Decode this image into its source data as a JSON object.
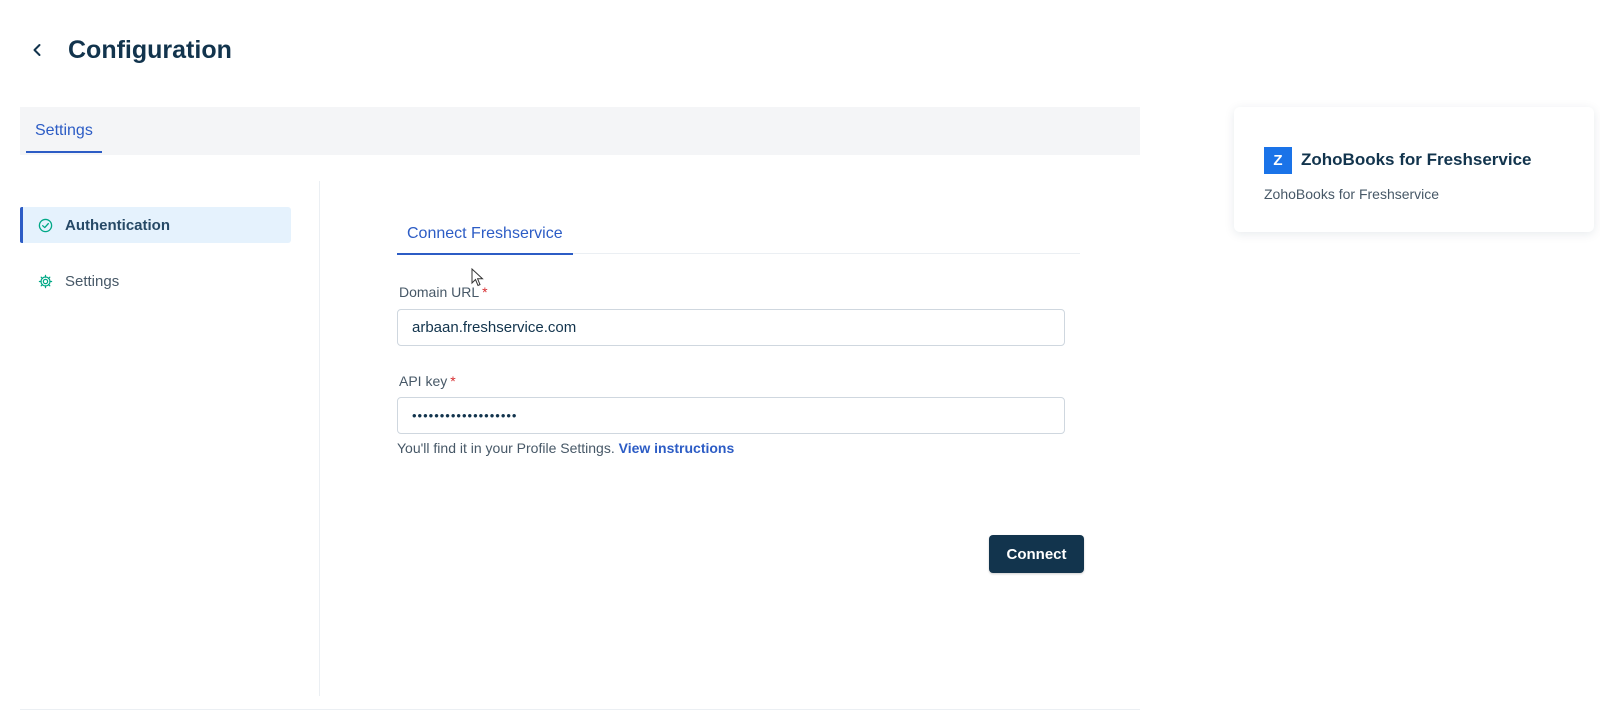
{
  "header": {
    "title": "Configuration",
    "back_icon": "chevron-left-icon"
  },
  "tabs": [
    {
      "label": "Settings",
      "active": true
    }
  ],
  "sidebar": {
    "items": [
      {
        "label": "Authentication",
        "icon": "check-circle-icon",
        "active": true
      },
      {
        "label": "Settings",
        "icon": "gear-icon",
        "active": false
      }
    ]
  },
  "main": {
    "tab_label": "Connect Freshservice",
    "domain": {
      "label": "Domain URL",
      "required_mark": "*",
      "value": "arbaan.freshservice.com"
    },
    "api_key": {
      "label": "API key",
      "required_mark": "*",
      "value": "•••••••••••••••••••"
    },
    "hint_text": "You'll find it in your Profile Settings.",
    "hint_link": "View instructions",
    "connect_label": "Connect"
  },
  "app_card": {
    "logo_letter": "Z",
    "name": "ZohoBooks for Freshservice",
    "subtitle": "ZohoBooks for Freshservice"
  },
  "colors": {
    "primary_text": "#12344d",
    "accent": "#2c5cc5",
    "button_bg": "#12344d",
    "required": "#d72d30",
    "active_nav_bg": "#e5f2fd",
    "logo_bg": "#1a73e8",
    "check_icon": "#00a886"
  }
}
